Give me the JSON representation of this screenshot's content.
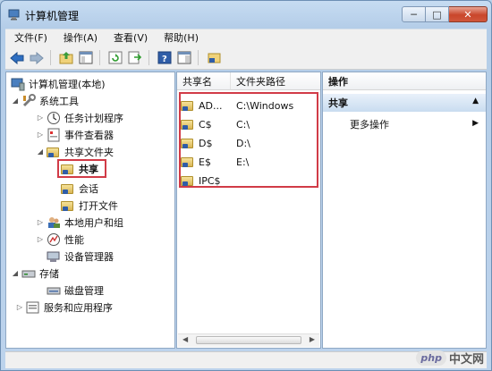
{
  "window": {
    "title": "计算机管理"
  },
  "caption_buttons": {
    "minimize": "─",
    "maximize": "□",
    "close": "✕"
  },
  "menu": [
    {
      "label": "文件(F)"
    },
    {
      "label": "操作(A)"
    },
    {
      "label": "查看(V)"
    },
    {
      "label": "帮助(H)"
    }
  ],
  "toolbar": {
    "icons": [
      "back-arrow-icon",
      "forward-arrow-icon",
      "up-folder-icon",
      "console-tree-icon",
      "refresh-icon",
      "export-icon",
      "help-icon",
      "show-hide-icon",
      "share-folder-icon"
    ]
  },
  "tree": {
    "root": "计算机管理(本地)",
    "system_tools": "系统工具",
    "task_scheduler": "任务计划程序",
    "event_viewer": "事件查看器",
    "shared_folders": "共享文件夹",
    "shares": "共享",
    "sessions": "会话",
    "open_files": "打开文件",
    "local_users": "本地用户和组",
    "performance": "性能",
    "device_manager": "设备管理器",
    "storage": "存储",
    "disk_management": "磁盘管理",
    "services_apps": "服务和应用程序"
  },
  "list": {
    "columns": {
      "name": "共享名",
      "path": "文件夹路径"
    },
    "rows": [
      {
        "name": "AD...",
        "path": "C:\\Windows"
      },
      {
        "name": "C$",
        "path": "C:\\"
      },
      {
        "name": "D$",
        "path": "D:\\"
      },
      {
        "name": "E$",
        "path": "E:\\"
      },
      {
        "name": "IPC$",
        "path": ""
      }
    ]
  },
  "actions": {
    "header": "操作",
    "section": "共享",
    "more": "更多操作"
  },
  "watermark": {
    "logo": "php",
    "text": "中文网"
  },
  "colors": {
    "highlight": "#d13b47",
    "accent": "#2f5da8"
  }
}
